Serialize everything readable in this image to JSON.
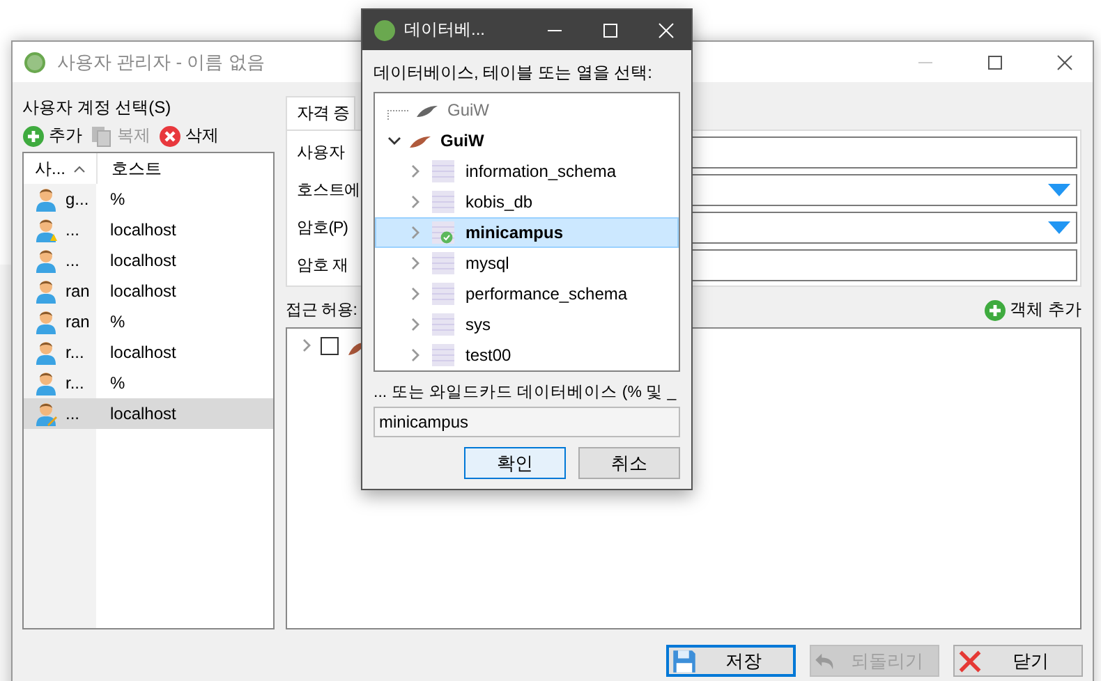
{
  "main_window": {
    "title": "사용자 관리자 - 이름 없음",
    "account_label": "사용자 계정 선택(S)",
    "toolbar": [
      {
        "label": "추가",
        "kind": "add",
        "disabled": false
      },
      {
        "label": "복제",
        "kind": "copy",
        "disabled": true
      },
      {
        "label": "삭제",
        "kind": "delete",
        "disabled": false
      }
    ],
    "user_table": {
      "columns": [
        "사...",
        "호스트"
      ],
      "rows": [
        {
          "user": "g...",
          "host": "%",
          "kind": "plain",
          "selected": false
        },
        {
          "user": "...",
          "host": "localhost",
          "kind": "warning",
          "selected": false
        },
        {
          "user": "...",
          "host": "localhost",
          "kind": "plain",
          "selected": false
        },
        {
          "user": "ran",
          "host": "localhost",
          "kind": "plain",
          "selected": false
        },
        {
          "user": "ran",
          "host": "%",
          "kind": "plain",
          "selected": false
        },
        {
          "user": "r...",
          "host": "localhost",
          "kind": "plain",
          "selected": false
        },
        {
          "user": "r...",
          "host": "%",
          "kind": "plain",
          "selected": false
        },
        {
          "user": "...",
          "host": "localhost",
          "kind": "edit",
          "selected": true
        }
      ]
    },
    "tab": "자격 증",
    "fields": [
      {
        "label": "사용자",
        "kind": "text"
      },
      {
        "label": "호스트에",
        "kind": "dropdown"
      },
      {
        "label": "암호(P)",
        "kind": "dropdown"
      },
      {
        "label": "암호 재",
        "kind": "text"
      }
    ],
    "access_label": "접근 허용:",
    "add_object_button": "객체 추가",
    "access_tree": [
      {
        "checked": false,
        "expanded": false
      }
    ],
    "buttons": [
      {
        "label": "저장",
        "kind": "save",
        "disabled": false,
        "focused": true
      },
      {
        "label": "되돌리기",
        "kind": "undo",
        "disabled": true,
        "focused": false
      },
      {
        "label": "닫기",
        "kind": "close",
        "disabled": false,
        "focused": false
      }
    ]
  },
  "dialog": {
    "title": "데이터베...",
    "prompt": "데이터베이스, 테이블 또는 열을 선택:",
    "tree": [
      {
        "label": "GuiW",
        "disabled": true,
        "expanded": false
      },
      {
        "label": "GuiW",
        "disabled": false,
        "expanded": true,
        "children": [
          {
            "label": "information_schema",
            "selected": false,
            "current": false
          },
          {
            "label": "kobis_db",
            "selected": false,
            "current": false
          },
          {
            "label": "minicampus",
            "selected": true,
            "current": true
          },
          {
            "label": "mysql",
            "selected": false,
            "current": false
          },
          {
            "label": "performance_schema",
            "selected": false,
            "current": false
          },
          {
            "label": "sys",
            "selected": false,
            "current": false
          },
          {
            "label": "test00",
            "selected": false,
            "current": false
          }
        ]
      }
    ],
    "wildcard_label": "... 또는 와일드카드 데이터베이스 (% 및 _",
    "wildcard_value": "minicampus",
    "buttons": [
      {
        "label": "확인",
        "focused": true
      },
      {
        "label": "취소",
        "focused": false
      }
    ]
  }
}
